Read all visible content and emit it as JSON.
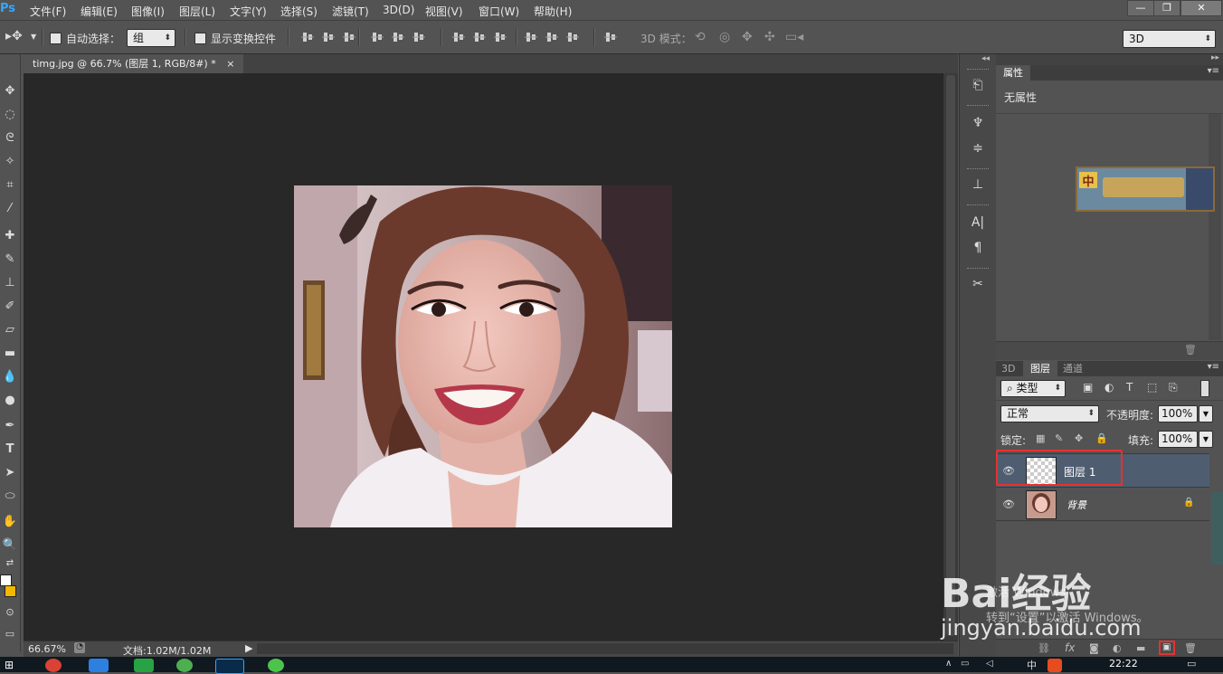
{
  "app": {
    "logo": "Ps",
    "menus": [
      "文件(F)",
      "编辑(E)",
      "图像(I)",
      "图层(L)",
      "文字(Y)",
      "选择(S)",
      "滤镜(T)",
      "3D(D)",
      "视图(V)",
      "窗口(W)",
      "帮助(H)"
    ],
    "window_controls": [
      "—",
      "❐",
      "✕"
    ]
  },
  "options": {
    "auto_select_label": "自动选择：",
    "auto_select_checked": false,
    "group_value": "组",
    "show_transform_label": "显示变换控件",
    "show_transform_checked": false,
    "mode_3d_label": "3D 模式：",
    "workspace_value": "3D"
  },
  "document": {
    "tab_title": "timg.jpg @ 66.7% (图层 1, RGB/8#) *",
    "tab_close": "×",
    "zoom": "66.67%",
    "doc_info": "文档:1.02M/1.02M"
  },
  "properties_panel": {
    "tab": "属性",
    "content": "无属性"
  },
  "layers_panel": {
    "tabs": [
      "3D",
      "图层",
      "通道"
    ],
    "active_tab": "图层",
    "filter_kind": "类型",
    "blend_mode": "正常",
    "opacity_label": "不透明度:",
    "opacity_value": "100%",
    "lock_label": "锁定:",
    "fill_label": "填充:",
    "fill_value": "100%",
    "layers": [
      {
        "name": "图层 1",
        "selected": true,
        "visible": true,
        "locked": false
      },
      {
        "name": "背景",
        "selected": false,
        "visible": true,
        "locked": true
      }
    ]
  },
  "watermark": {
    "activate_line1": "激活 Windows",
    "activate_line2": "转到“设置”以激活 Windows。",
    "brand": "Bai经验",
    "site": "jingyan.baidu.com"
  },
  "taskbar": {
    "time": "22:22",
    "tray_text": "中"
  },
  "colors": {
    "highlight_box": "#e8312f",
    "layer_selected": "#4f5d70",
    "chrome": "#535353",
    "canvas_bg": "#282828"
  }
}
